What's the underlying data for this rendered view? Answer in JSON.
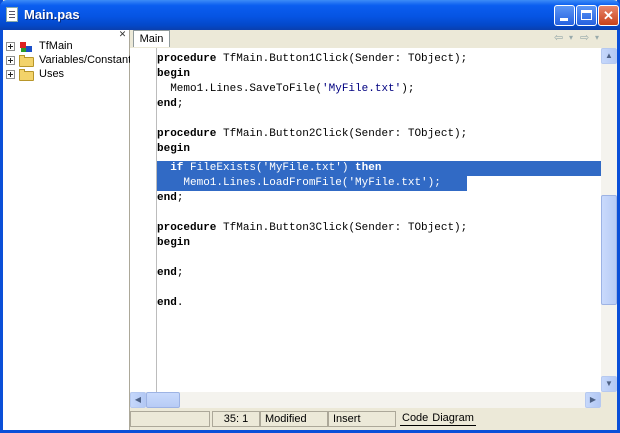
{
  "window": {
    "title": "Main.pas"
  },
  "tree": {
    "items": [
      {
        "label": "TfMain",
        "icon": "class-icon"
      },
      {
        "label": "Variables/Constants",
        "icon": "folder-icon"
      },
      {
        "label": "Uses",
        "icon": "folder-icon"
      }
    ]
  },
  "tabs": {
    "active": "Main"
  },
  "code": {
    "lines": [
      {
        "kw": "procedure",
        "rest": " TfMain.Button1Click(Sender: TObject);"
      },
      {
        "kw": "begin",
        "rest": ""
      },
      {
        "pre": "  Memo1.Lines.SaveToFile(",
        "str": "'MyFile.txt'",
        "post": ");"
      },
      {
        "kw": "end",
        "rest": ";"
      },
      {
        "kw": "procedure",
        "rest": " TfMain.Button2Click(Sender: TObject);"
      },
      {
        "kw": "begin",
        "rest": ""
      },
      {
        "pre1": "  ",
        "kw1": "if",
        "mid": " FileExists(",
        "str": "'MyFile.txt'",
        "mid2": ") ",
        "kw2": "then"
      },
      {
        "pre": "    Memo1.Lines.LoadFromFile(",
        "str": "'MyFile.txt'",
        "post": ");"
      },
      {
        "kw": "end",
        "rest": ";"
      },
      {
        "kw": "procedure",
        "rest": " TfMain.Button3Click(Sender: TObject);"
      },
      {
        "kw": "begin",
        "rest": ""
      },
      {
        "kw": "end",
        "rest": ";"
      },
      {
        "kw": "end",
        "rest": "."
      }
    ]
  },
  "status": {
    "position": "35:  1",
    "modified": "Modified",
    "mode": "Insert",
    "tab_code": "Code",
    "tab_diagram": "Diagram"
  },
  "nav": {
    "back": "⇦",
    "forward": "⇨"
  }
}
